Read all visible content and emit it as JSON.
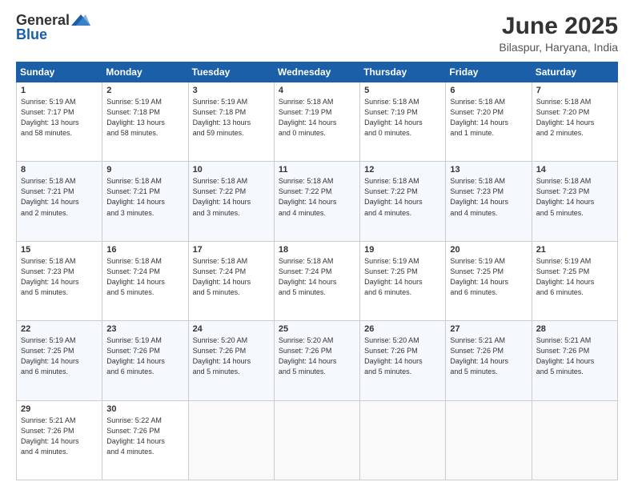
{
  "header": {
    "logo_general": "General",
    "logo_blue": "Blue",
    "title": "June 2025",
    "subtitle": "Bilaspur, Haryana, India"
  },
  "days_of_week": [
    "Sunday",
    "Monday",
    "Tuesday",
    "Wednesday",
    "Thursday",
    "Friday",
    "Saturday"
  ],
  "weeks": [
    [
      {
        "day": "1",
        "info": "Sunrise: 5:19 AM\nSunset: 7:17 PM\nDaylight: 13 hours\nand 58 minutes."
      },
      {
        "day": "2",
        "info": "Sunrise: 5:19 AM\nSunset: 7:18 PM\nDaylight: 13 hours\nand 58 minutes."
      },
      {
        "day": "3",
        "info": "Sunrise: 5:19 AM\nSunset: 7:18 PM\nDaylight: 13 hours\nand 59 minutes."
      },
      {
        "day": "4",
        "info": "Sunrise: 5:18 AM\nSunset: 7:19 PM\nDaylight: 14 hours\nand 0 minutes."
      },
      {
        "day": "5",
        "info": "Sunrise: 5:18 AM\nSunset: 7:19 PM\nDaylight: 14 hours\nand 0 minutes."
      },
      {
        "day": "6",
        "info": "Sunrise: 5:18 AM\nSunset: 7:20 PM\nDaylight: 14 hours\nand 1 minute."
      },
      {
        "day": "7",
        "info": "Sunrise: 5:18 AM\nSunset: 7:20 PM\nDaylight: 14 hours\nand 2 minutes."
      }
    ],
    [
      {
        "day": "8",
        "info": "Sunrise: 5:18 AM\nSunset: 7:21 PM\nDaylight: 14 hours\nand 2 minutes."
      },
      {
        "day": "9",
        "info": "Sunrise: 5:18 AM\nSunset: 7:21 PM\nDaylight: 14 hours\nand 3 minutes."
      },
      {
        "day": "10",
        "info": "Sunrise: 5:18 AM\nSunset: 7:22 PM\nDaylight: 14 hours\nand 3 minutes."
      },
      {
        "day": "11",
        "info": "Sunrise: 5:18 AM\nSunset: 7:22 PM\nDaylight: 14 hours\nand 4 minutes."
      },
      {
        "day": "12",
        "info": "Sunrise: 5:18 AM\nSunset: 7:22 PM\nDaylight: 14 hours\nand 4 minutes."
      },
      {
        "day": "13",
        "info": "Sunrise: 5:18 AM\nSunset: 7:23 PM\nDaylight: 14 hours\nand 4 minutes."
      },
      {
        "day": "14",
        "info": "Sunrise: 5:18 AM\nSunset: 7:23 PM\nDaylight: 14 hours\nand 5 minutes."
      }
    ],
    [
      {
        "day": "15",
        "info": "Sunrise: 5:18 AM\nSunset: 7:23 PM\nDaylight: 14 hours\nand 5 minutes."
      },
      {
        "day": "16",
        "info": "Sunrise: 5:18 AM\nSunset: 7:24 PM\nDaylight: 14 hours\nand 5 minutes."
      },
      {
        "day": "17",
        "info": "Sunrise: 5:18 AM\nSunset: 7:24 PM\nDaylight: 14 hours\nand 5 minutes."
      },
      {
        "day": "18",
        "info": "Sunrise: 5:18 AM\nSunset: 7:24 PM\nDaylight: 14 hours\nand 5 minutes."
      },
      {
        "day": "19",
        "info": "Sunrise: 5:19 AM\nSunset: 7:25 PM\nDaylight: 14 hours\nand 6 minutes."
      },
      {
        "day": "20",
        "info": "Sunrise: 5:19 AM\nSunset: 7:25 PM\nDaylight: 14 hours\nand 6 minutes."
      },
      {
        "day": "21",
        "info": "Sunrise: 5:19 AM\nSunset: 7:25 PM\nDaylight: 14 hours\nand 6 minutes."
      }
    ],
    [
      {
        "day": "22",
        "info": "Sunrise: 5:19 AM\nSunset: 7:25 PM\nDaylight: 14 hours\nand 6 minutes."
      },
      {
        "day": "23",
        "info": "Sunrise: 5:19 AM\nSunset: 7:26 PM\nDaylight: 14 hours\nand 6 minutes."
      },
      {
        "day": "24",
        "info": "Sunrise: 5:20 AM\nSunset: 7:26 PM\nDaylight: 14 hours\nand 5 minutes."
      },
      {
        "day": "25",
        "info": "Sunrise: 5:20 AM\nSunset: 7:26 PM\nDaylight: 14 hours\nand 5 minutes."
      },
      {
        "day": "26",
        "info": "Sunrise: 5:20 AM\nSunset: 7:26 PM\nDaylight: 14 hours\nand 5 minutes."
      },
      {
        "day": "27",
        "info": "Sunrise: 5:21 AM\nSunset: 7:26 PM\nDaylight: 14 hours\nand 5 minutes."
      },
      {
        "day": "28",
        "info": "Sunrise: 5:21 AM\nSunset: 7:26 PM\nDaylight: 14 hours\nand 5 minutes."
      }
    ],
    [
      {
        "day": "29",
        "info": "Sunrise: 5:21 AM\nSunset: 7:26 PM\nDaylight: 14 hours\nand 4 minutes."
      },
      {
        "day": "30",
        "info": "Sunrise: 5:22 AM\nSunset: 7:26 PM\nDaylight: 14 hours\nand 4 minutes."
      },
      {
        "day": "",
        "info": ""
      },
      {
        "day": "",
        "info": ""
      },
      {
        "day": "",
        "info": ""
      },
      {
        "day": "",
        "info": ""
      },
      {
        "day": "",
        "info": ""
      }
    ]
  ]
}
